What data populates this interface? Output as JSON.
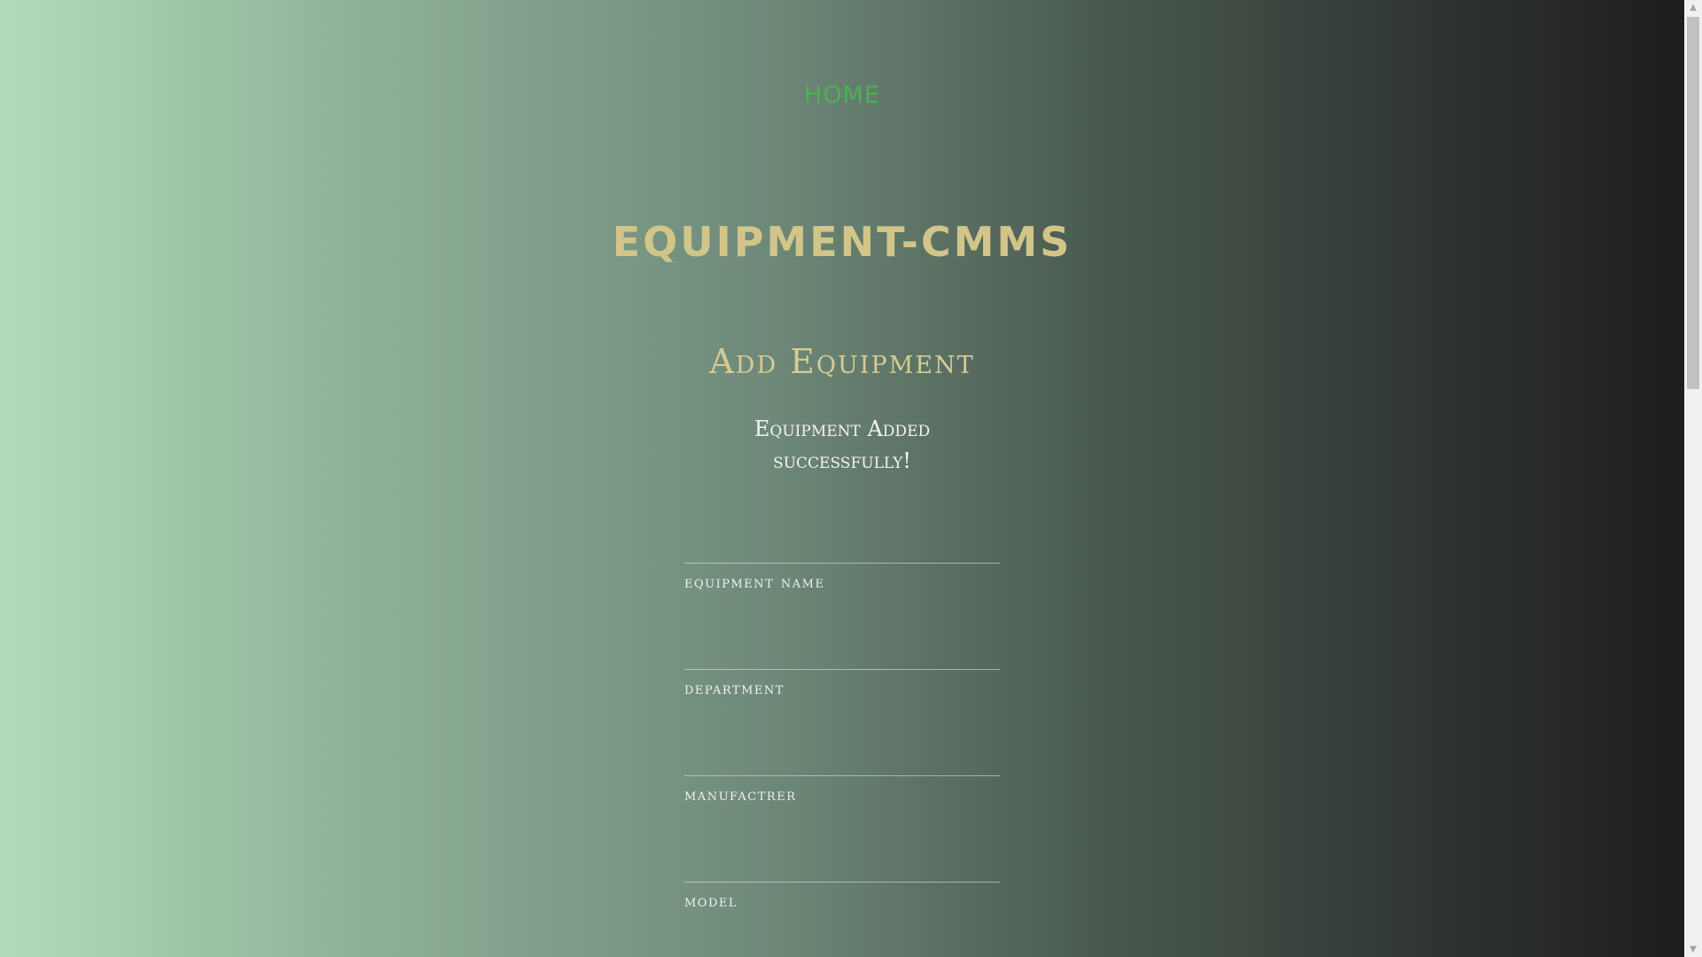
{
  "nav": {
    "home_label": "HOME"
  },
  "header": {
    "site_title": "EQUIPMENT-CMMS",
    "page_heading": "Add Equipment"
  },
  "status": {
    "message": "Equipment Added successfully!"
  },
  "form": {
    "fields": [
      {
        "label": "equipment name",
        "value": ""
      },
      {
        "label": "department",
        "value": ""
      },
      {
        "label": "manufactrer",
        "value": ""
      },
      {
        "label": "model",
        "value": ""
      }
    ]
  },
  "colors": {
    "nav_link": "#4cb153",
    "title": "#d2c589",
    "heading": "#d6cb93",
    "gradient_left": "#b1dcba",
    "gradient_right": "#1d1d1d"
  }
}
